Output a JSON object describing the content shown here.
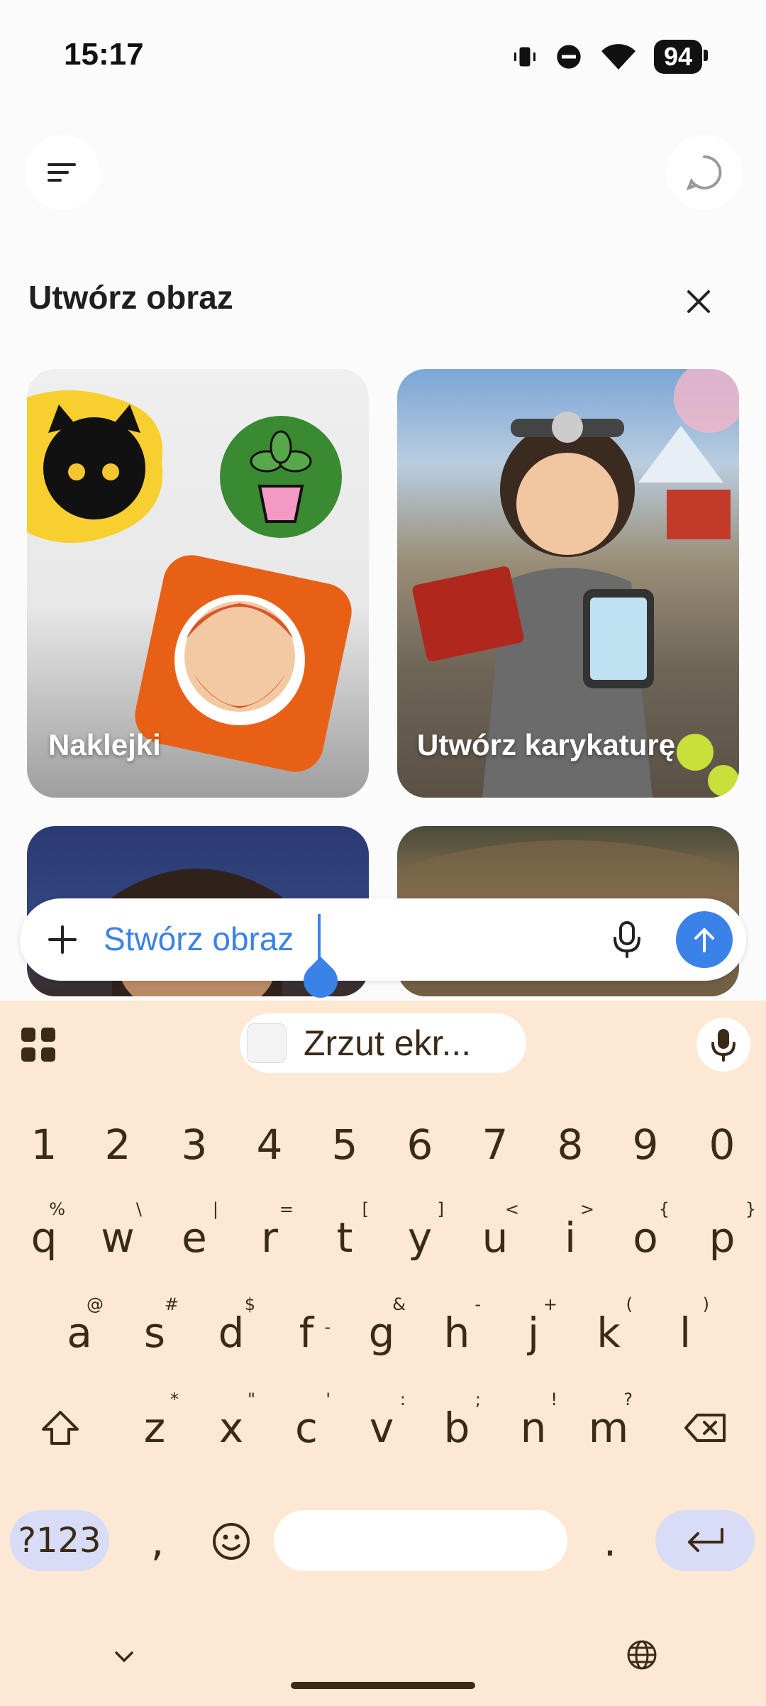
{
  "status_bar": {
    "time": "15:17",
    "battery": "94",
    "icons": [
      "vibrate-icon",
      "dnd-icon",
      "wifi-icon",
      "battery-icon"
    ]
  },
  "header": {
    "menu_icon": "menu-icon",
    "chat_icon": "chat-icon"
  },
  "section": {
    "title": "Utwórz obraz",
    "close_icon": "close-icon"
  },
  "cards": [
    {
      "label": "Naklejki"
    },
    {
      "label": "Utwórz karykaturę"
    },
    {
      "label": ""
    },
    {
      "label": ""
    }
  ],
  "prompt": {
    "value": "Stwórz obraz",
    "plus_icon": "plus-icon",
    "mic_icon": "mic-icon",
    "send_icon": "arrow-up-icon"
  },
  "keyboard": {
    "clipboard_chip": "Zrzut ekr...",
    "number_row": [
      "1",
      "2",
      "3",
      "4",
      "5",
      "6",
      "7",
      "8",
      "9",
      "0"
    ],
    "row1": [
      {
        "key": "q",
        "hint": "%"
      },
      {
        "key": "w",
        "hint": "\\"
      },
      {
        "key": "e",
        "hint": "|"
      },
      {
        "key": "r",
        "hint": "="
      },
      {
        "key": "t",
        "hint": "["
      },
      {
        "key": "y",
        "hint": "]"
      },
      {
        "key": "u",
        "hint": "<"
      },
      {
        "key": "i",
        "hint": ">"
      },
      {
        "key": "o",
        "hint": "{"
      },
      {
        "key": "p",
        "hint": "}"
      }
    ],
    "row2": [
      {
        "key": "a",
        "hint": "@"
      },
      {
        "key": "s",
        "hint": "#"
      },
      {
        "key": "d",
        "hint": "$"
      },
      {
        "key": "f",
        "hint": "-"
      },
      {
        "key": "g",
        "hint": "&"
      },
      {
        "key": "h",
        "hint": "-"
      },
      {
        "key": "j",
        "hint": "+"
      },
      {
        "key": "k",
        "hint": "("
      },
      {
        "key": "l",
        "hint": ")"
      }
    ],
    "row3": [
      {
        "key": "z",
        "hint": "*"
      },
      {
        "key": "x",
        "hint": "\""
      },
      {
        "key": "c",
        "hint": "'"
      },
      {
        "key": "v",
        "hint": ":"
      },
      {
        "key": "b",
        "hint": ";"
      },
      {
        "key": "n",
        "hint": "!"
      },
      {
        "key": "m",
        "hint": "?"
      }
    ],
    "sym_label": "?123",
    "comma": ",",
    "period": "."
  },
  "colors": {
    "accent": "#3b82e8",
    "keyboard_bg": "#fde8d3",
    "key_text": "#3b2a18",
    "sym_key_bg": "#d8dcf6"
  }
}
